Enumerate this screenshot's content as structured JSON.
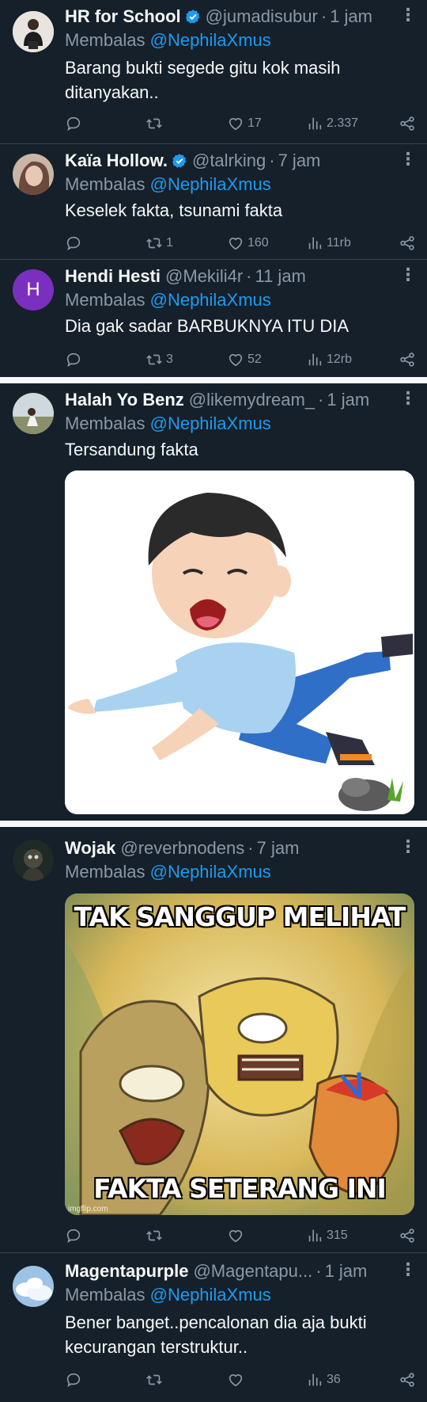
{
  "tweets": [
    {
      "name": "HR for School",
      "verified": true,
      "handle": "@jumadisubur",
      "time": "1 jam",
      "reply_prefix": "Membalas",
      "reply_to": "@NephilaXmus",
      "text": "Barang bukti segede gitu kok masih ditanyakan..",
      "replies": "",
      "retweets": "",
      "likes": "17",
      "views": "2.337"
    },
    {
      "name": "Kaïa Hollow.",
      "verified": true,
      "handle": "@talrking",
      "time": "7 jam",
      "reply_prefix": "Membalas",
      "reply_to": "@NephilaXmus",
      "text": "Keselek fakta, tsunami fakta",
      "replies": "",
      "retweets": "1",
      "likes": "160",
      "views": "11rb"
    },
    {
      "name": "Hendi Hesti",
      "verified": false,
      "handle": "@Mekili4r",
      "time": "11 jam",
      "avatar_letter": "H",
      "reply_prefix": "Membalas",
      "reply_to": "@NephilaXmus",
      "text": "Dia gak sadar BARBUKNYA ITU DIA",
      "replies": "",
      "retweets": "3",
      "likes": "52",
      "views": "12rb"
    },
    {
      "name": "Halah Yo Benz",
      "verified": false,
      "handle": "@likemydream_",
      "time": "1 jam",
      "reply_prefix": "Membalas",
      "reply_to": "@NephilaXmus",
      "text": "Tersandung fakta"
    },
    {
      "name": "Wojak",
      "verified": false,
      "handle": "@reverbnodens",
      "time": "7 jam",
      "reply_prefix": "Membalas",
      "reply_to": "@NephilaXmus",
      "meme_top": "TAK SANGGUP MELIHAT",
      "meme_bottom": "FAKTA SETERANG INI",
      "meme_watermark": "imgflip.com",
      "replies": "",
      "retweets": "",
      "likes": "",
      "views": "315"
    },
    {
      "name": "Magentapurple",
      "verified": false,
      "handle": "@Magentapu...",
      "time": "1 jam",
      "reply_prefix": "Membalas",
      "reply_to": "@NephilaXmus",
      "text": "Bener banget..pencalonan dia aja bukti kecurangan terstruktur..",
      "replies": "",
      "retweets": "",
      "likes": "",
      "views": "36"
    }
  ],
  "icons": {
    "reply": "reply-icon",
    "retweet": "retweet-icon",
    "like": "heart-icon",
    "views": "views-icon",
    "share": "share-icon",
    "more": "more-icon",
    "verified": "verified-badge-icon"
  },
  "colors": {
    "background": "#15202b",
    "text": "#f7f9f9",
    "muted": "#8b98a5",
    "accent": "#1d9bf0",
    "separator": "#f7f9f9"
  }
}
